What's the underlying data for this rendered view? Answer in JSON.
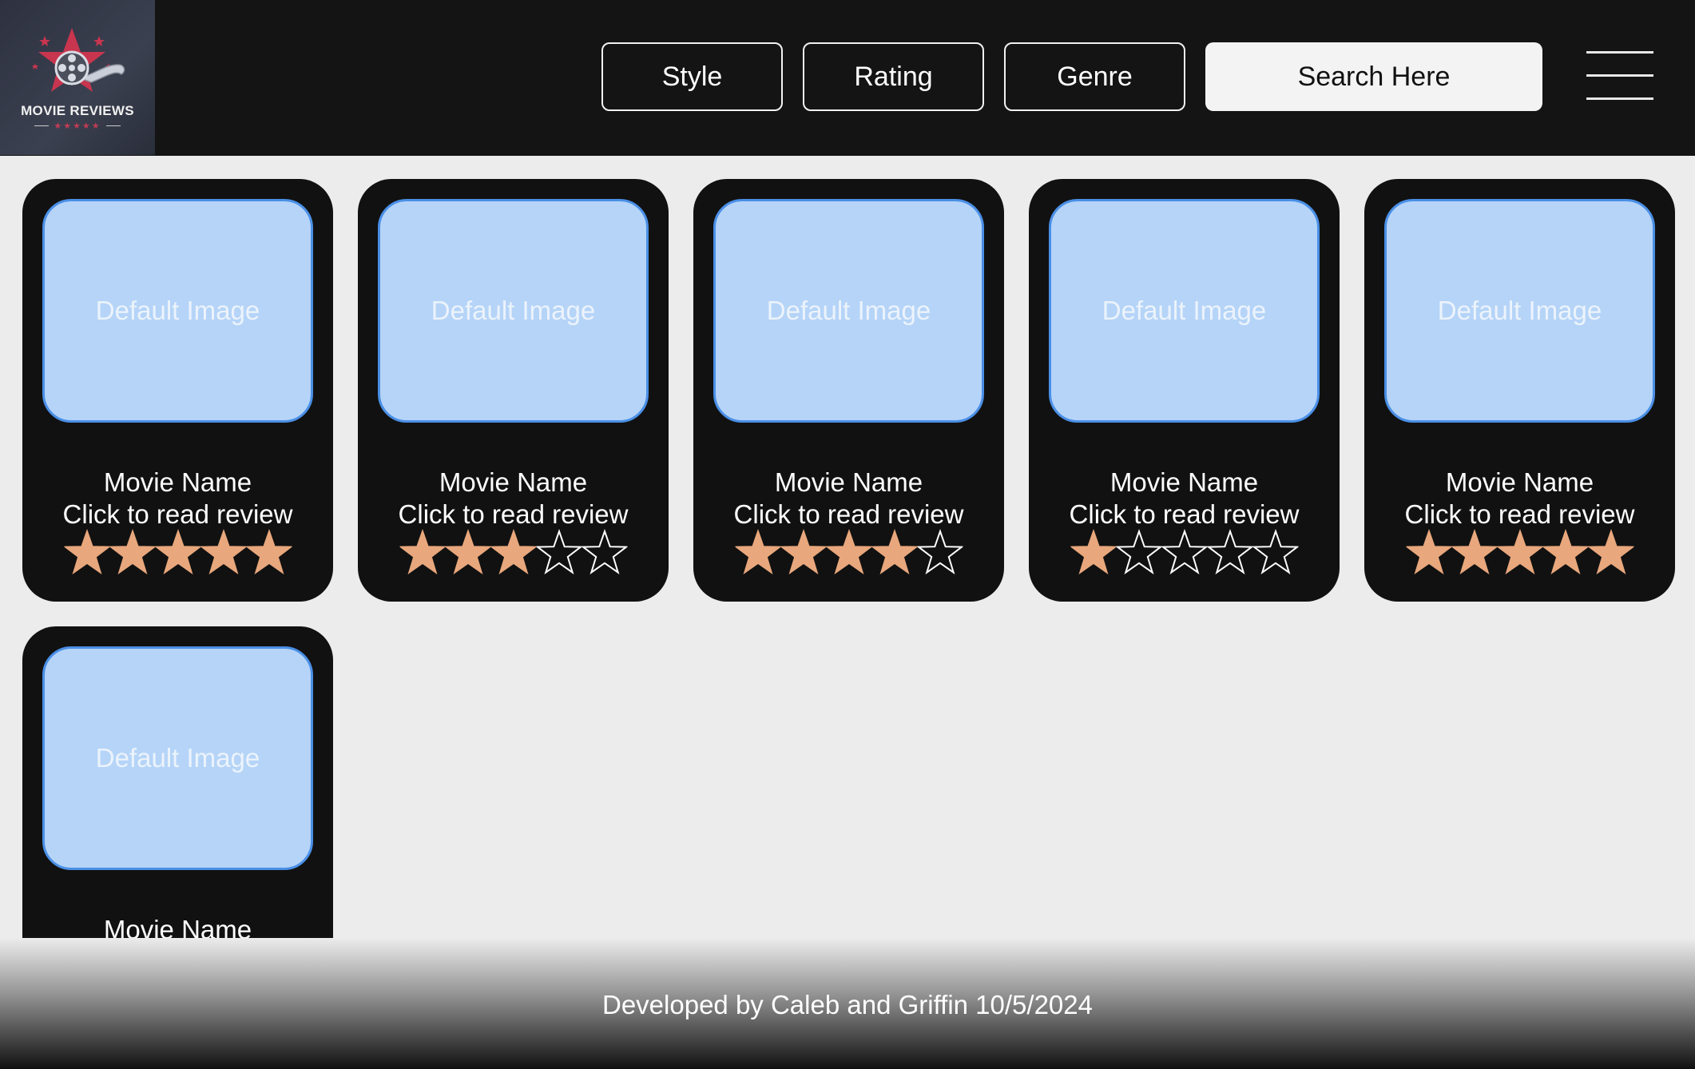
{
  "header": {
    "logo": {
      "text": "MOVIE REVIEWS",
      "stars": "★★★★★"
    },
    "buttons": [
      "Style",
      "Rating",
      "Genre"
    ],
    "search_label": "Search Here"
  },
  "cards": [
    {
      "image_text": "Default Image",
      "name": "Movie Name",
      "review": "Click to read review",
      "rating": 5
    },
    {
      "image_text": "Default Image",
      "name": "Movie Name",
      "review": "Click to read review",
      "rating": 3
    },
    {
      "image_text": "Default Image",
      "name": "Movie Name",
      "review": "Click to read review",
      "rating": 4
    },
    {
      "image_text": "Default Image",
      "name": "Movie Name",
      "review": "Click to read review",
      "rating": 1
    },
    {
      "image_text": "Default Image",
      "name": "Movie Name",
      "review": "Click to read review",
      "rating": 5
    },
    {
      "image_text": "Default Image",
      "name": "Movie Name"
    }
  ],
  "footer": {
    "text": "Developed by Caleb and Griffin 10/5/2024"
  },
  "colors": {
    "header_bg": "#141414",
    "card_bg": "#111111",
    "image_fill": "#b5d4f8",
    "image_border": "#4a8fe6",
    "star_fill": "#e8a77c",
    "page_bg": "#ececec"
  }
}
